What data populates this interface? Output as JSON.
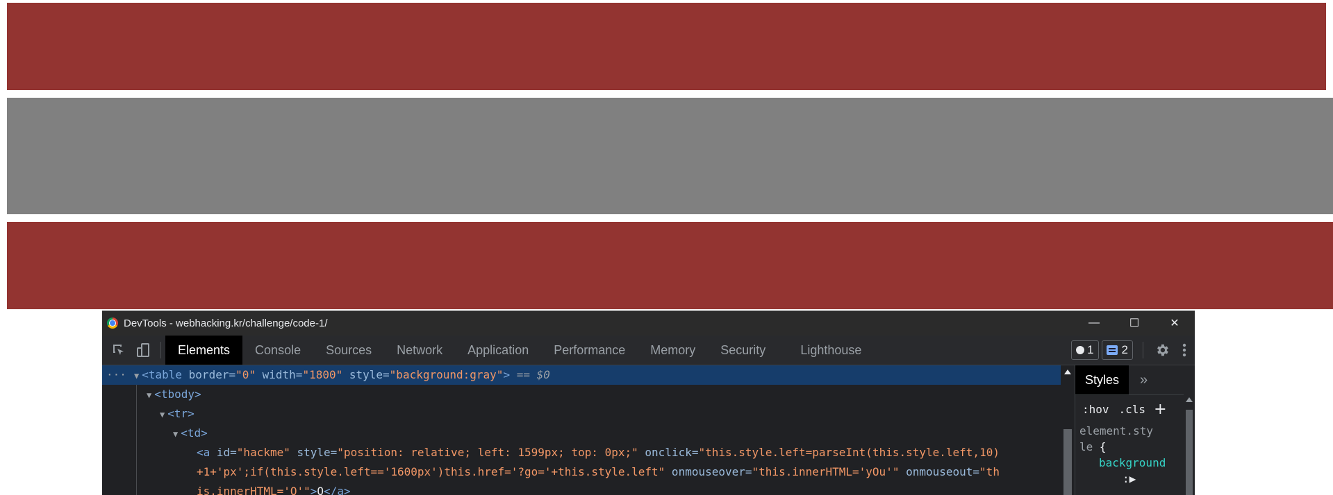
{
  "colors": {
    "red_bar": "#933431",
    "gray_bar": "#808080"
  },
  "devtools": {
    "title": "DevTools - webhacking.kr/challenge/code-1/",
    "window_controls": {
      "minimize": "—",
      "maximize": "☐",
      "close": "✕"
    },
    "tabs": [
      {
        "label": "Elements",
        "active": true
      },
      {
        "label": "Console"
      },
      {
        "label": "Sources"
      },
      {
        "label": "Network"
      },
      {
        "label": "Application"
      },
      {
        "label": "Performance"
      },
      {
        "label": "Memory"
      },
      {
        "label": "Security"
      },
      {
        "label": "Lighthouse"
      }
    ],
    "badges": {
      "issues_count": "1",
      "messages_count": "2"
    },
    "dom": {
      "ellipsis": "···",
      "line1": {
        "open": "<table",
        "a1_name": " border=",
        "a1_val": "\"0\"",
        "a2_name": " width=",
        "a2_val": "\"1800\"",
        "a3_name": " style=",
        "a3_val": "\"background:gray\"",
        "close": ">",
        "ref": " == $0"
      },
      "line2": "<tbody>",
      "line3": "<tr>",
      "line4": "<td>",
      "line5": {
        "open": "<a",
        "id_name": " id=",
        "id_val": "\"hackme\"",
        "style_name": " style=",
        "style_val": "\"position: relative; left: 1599px; top: 0px;\"",
        "onclick_name": " onclick=",
        "onclick_val": "\"this.style.left=parseInt(this.style.left,10)"
      },
      "line6": {
        "val": "+1+'px';if(this.style.left=='1600px')this.href='?go='+this.style.left\"",
        "over_name": " onmouseover=",
        "over_val": "\"this.innerHTML='yOu'\"",
        "out_name": " onmouseout=",
        "out_val": "\"th"
      },
      "line7": {
        "val": "is.innerHTML='O'\"",
        "tag_close": ">",
        "text": "O",
        "end_tag": "</a>"
      }
    },
    "styles": {
      "tab_label": "Styles",
      "more": "»",
      "hov": ":hov",
      "cls": ".cls",
      "add": "+",
      "selector_line1": "element.sty",
      "selector_line2": "le",
      "brace_open": " {",
      "property": "background",
      "colon_line": ":▶"
    }
  }
}
